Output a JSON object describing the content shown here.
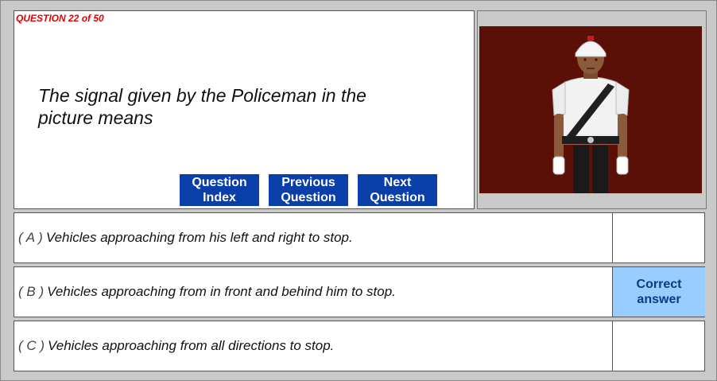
{
  "question": {
    "number_label": "QUESTION 22 of 50",
    "text": "The signal given by the Policeman in the picture means"
  },
  "nav": {
    "index": [
      "Question",
      "Index"
    ],
    "previous": [
      "Previous",
      "Question"
    ],
    "next": [
      "Next",
      "Question"
    ]
  },
  "image": {
    "icon": "traffic-policeman-illustration",
    "background_color": "#5a1006"
  },
  "options": [
    {
      "letter": "( A )",
      "text": "Vehicles approaching from his left and right to stop.",
      "mark": [
        "",
        ""
      ],
      "correct": false
    },
    {
      "letter": "( B )",
      "text": "Vehicles approaching from in front and behind him to stop.",
      "mark": [
        "Correct",
        "answer"
      ],
      "correct": true
    },
    {
      "letter": "( C )",
      "text": "Vehicles approaching from all directions to stop.",
      "mark": [
        "",
        ""
      ],
      "correct": false
    }
  ],
  "colors": {
    "accent": "#0a3ea8",
    "question_number": "#e00000",
    "correct_bg": "#99ccff",
    "frame_bg": "#c9c9c9"
  }
}
